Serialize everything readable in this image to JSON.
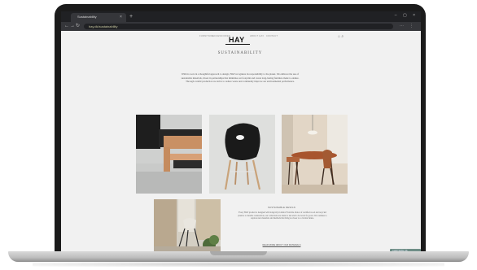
{
  "browser": {
    "tab_title": "Sustainability",
    "tab_close": "×",
    "new_tab": "+",
    "window_controls": "– ▢ ×",
    "url": "hay.dk/sustainability",
    "back": "←",
    "forward": "→",
    "reload": "↻"
  },
  "site": {
    "logo": "HAY",
    "nav": [
      "FURNITURE",
      "ACCESSORIES",
      "ABOUT HAY",
      "CONTACT"
    ],
    "title": "SUSTAINABILITY",
    "intro": "With its roots in a thoughtful approach to design, HAY recognizes its responsibility to the planet. We embrace the use of sustainable materials, invest in partnerships that minimise our footprint and create long-lasting furniture made to endure. Through careful production we strive to reduce waste and continually improve our environmental performance.",
    "caption_title": "SUSTAINABLE DESIGN",
    "caption_text": "Every HAY product is designed with longevity in mind. From the choice of certified wood and recycled plastics to durable construction, our collections are made to last and to be loved for years. We continue to explore new materials and methods that bring us closer to a circular future.",
    "caption_link": "READ MORE ABOUT OUR MATERIALS",
    "chat": "CHAT WITH US"
  },
  "colors": {
    "chrome_dark": "#202124",
    "chrome_mid": "#35363a",
    "page_bg": "#f1f1f1",
    "accent": "#6f8e87"
  },
  "icons": [
    "back-icon",
    "forward-icon",
    "reload-icon",
    "search-icon",
    "bag-icon",
    "menu-icon"
  ]
}
